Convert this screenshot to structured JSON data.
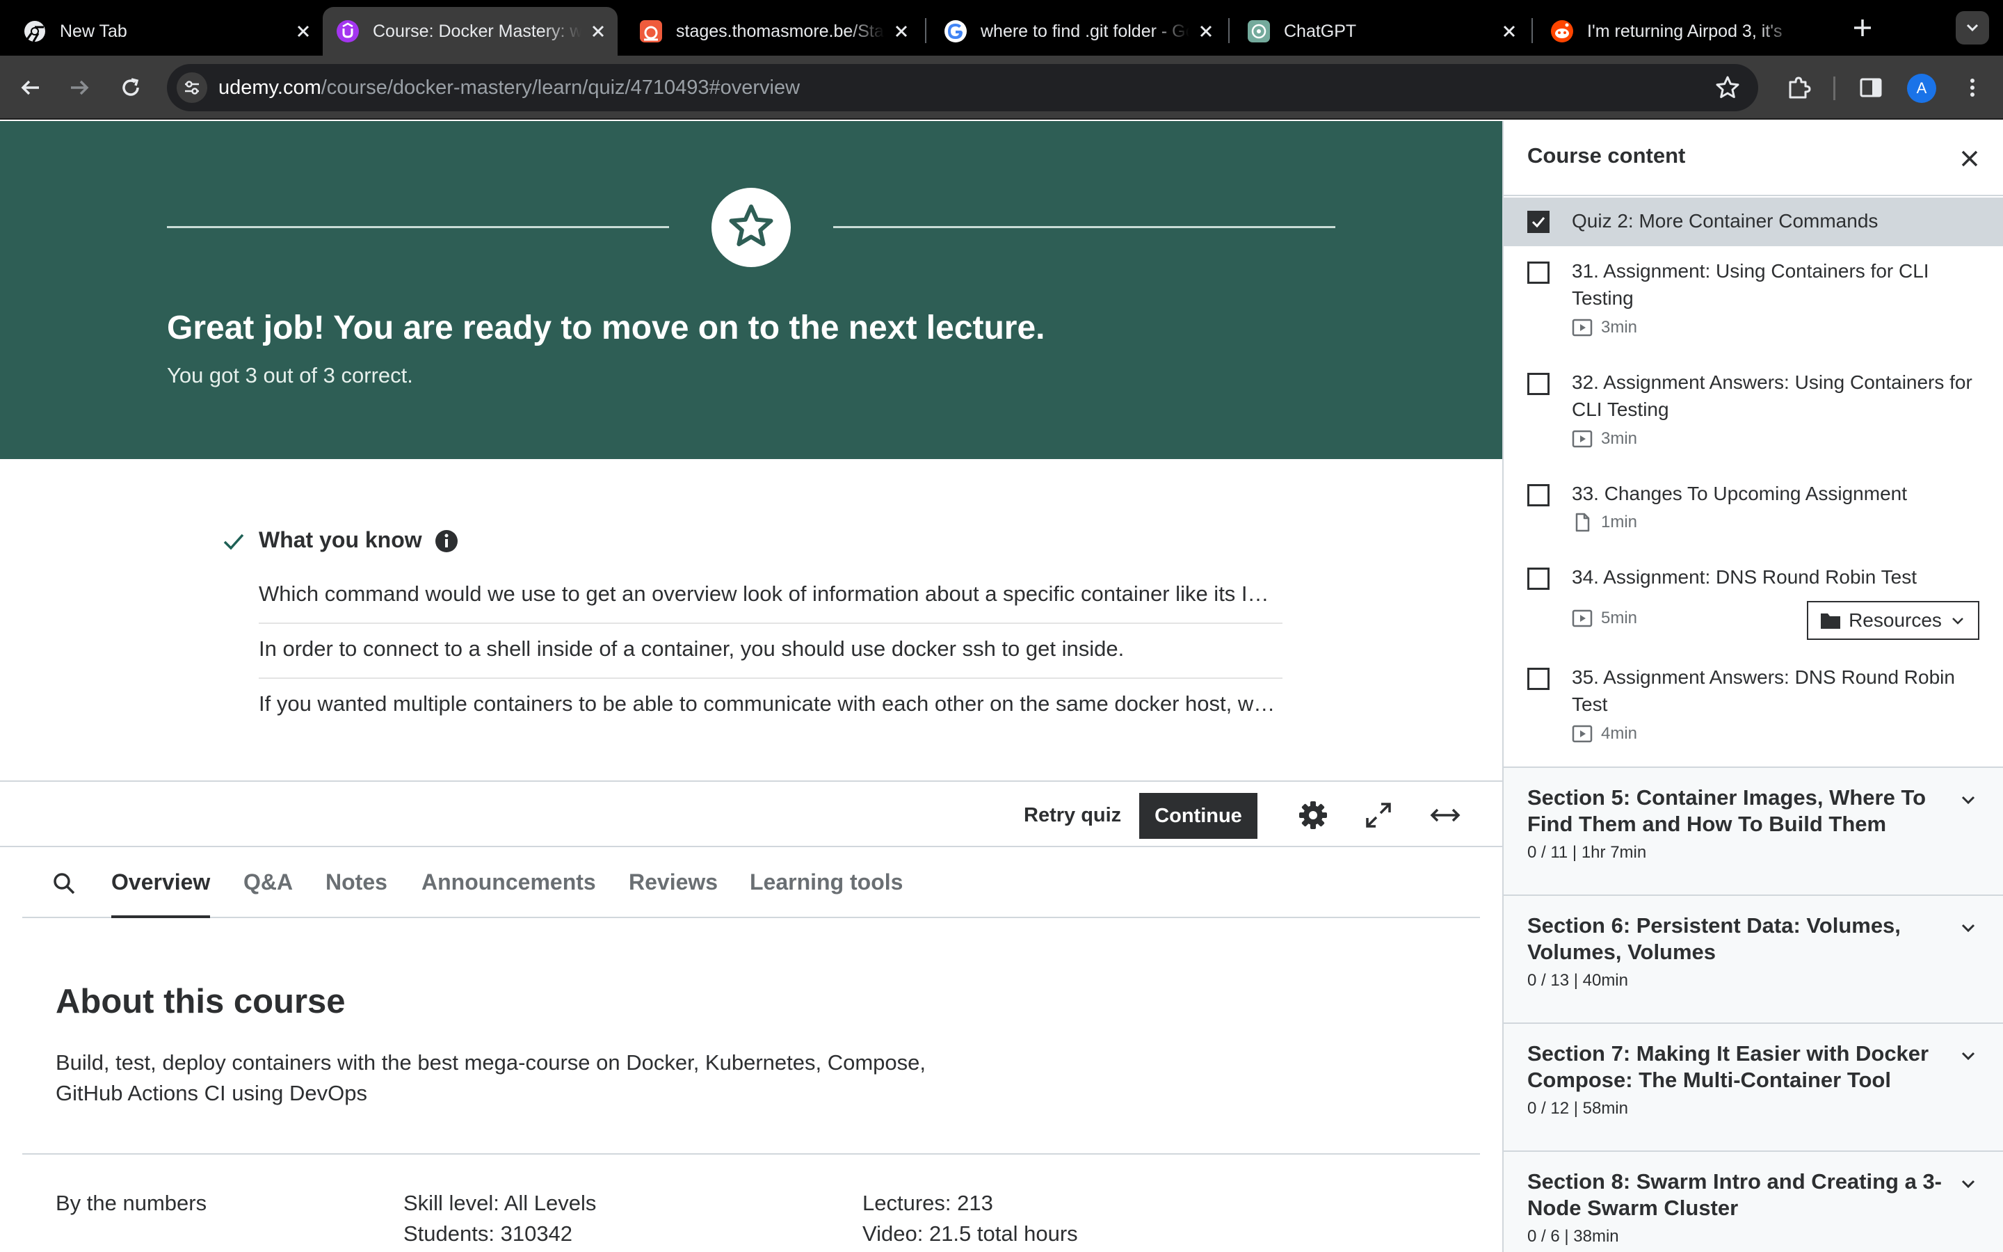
{
  "browser": {
    "tabs": [
      {
        "title": "New Tab"
      },
      {
        "title": "Course: Docker Mastery: with Kubernetes +Swarm"
      },
      {
        "title": "stages.thomasmore.be/Stages"
      },
      {
        "title": "where to find .git folder - Google Search"
      },
      {
        "title": "ChatGPT"
      },
      {
        "title": "I'm returning Airpod 3, it's"
      }
    ],
    "url_host": "udemy.com",
    "url_path": "/course/docker-mastery/learn/quiz/4710493#overview",
    "profile_initial": "A"
  },
  "hero": {
    "headline": "Great job! You are ready to move on to the next lecture.",
    "subtext": "You got 3 out of 3 correct.",
    "color": "#2e5e55"
  },
  "what_you_know": {
    "title": "What you know",
    "items": [
      "Which command would we use to get an overview look of information about a specific container like its IP address and configuration?",
      "In order to connect to a shell inside of a container, you should use docker ssh to get inside.",
      "If you wanted multiple containers to be able to communicate with each other on the same docker host, which network would you use?"
    ]
  },
  "controls": {
    "retry_label": "Retry quiz",
    "continue_label": "Continue"
  },
  "course_tabs": [
    "Overview",
    "Q&A",
    "Notes",
    "Announcements",
    "Reviews",
    "Learning tools"
  ],
  "about": {
    "title": "About this course",
    "description": "Build, test, deploy containers with the best mega-course on Docker, Kubernetes, Compose, GitHub Actions CI using DevOps",
    "numbers_label": "By the numbers",
    "skill_level": "Skill level: All Levels",
    "students": "Students: 310342",
    "lectures": "Lectures: 213",
    "video": "Video: 21.5 total hours"
  },
  "sidebar": {
    "title": "Course content",
    "lectures": [
      {
        "title": "Quiz 2: More Container Commands",
        "meta": "",
        "checked": true
      },
      {
        "title": "31. Assignment: Using Containers for CLI Testing",
        "meta": "3min",
        "icon": "video"
      },
      {
        "title": "32. Assignment Answers: Using Containers for CLI Testing",
        "meta": "3min",
        "icon": "video"
      },
      {
        "title": "33. Changes To Upcoming Assignment",
        "meta": "1min",
        "icon": "file"
      },
      {
        "title": "34. Assignment: DNS Round Robin Test",
        "meta": "5min",
        "icon": "video"
      },
      {
        "title": "35. Assignment Answers: DNS Round Robin Test",
        "meta": "4min",
        "icon": "video"
      }
    ],
    "resources_label": "Resources",
    "sections": [
      {
        "title": "Section 5: Container Images, Where To Find Them and How To Build Them",
        "meta": "0 / 11 | 1hr 7min"
      },
      {
        "title": "Section 6: Persistent Data: Volumes, Volumes, Volumes",
        "meta": "0 / 13 | 40min"
      },
      {
        "title": "Section 7: Making It Easier with Docker Compose: The Multi-Container Tool",
        "meta": "0 / 12 | 58min"
      },
      {
        "title": "Section 8: Swarm Intro and Creating a 3-Node Swarm Cluster",
        "meta": "0 / 6 | 38min"
      }
    ]
  }
}
